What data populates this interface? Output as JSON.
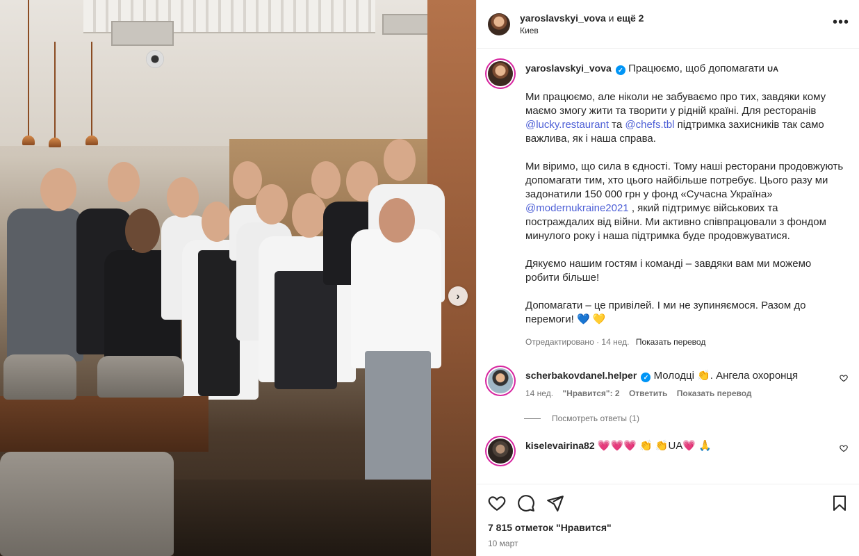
{
  "header": {
    "username": "yaroslavskyi_vova",
    "and_text": "и",
    "more_text": "ещё 2",
    "location": "Киев",
    "menu_icon": "more-horizontal-icon"
  },
  "post": {
    "author": "yaroslavskyi_vova",
    "verified_mark": "✓",
    "caption_title": "Працюємо, щоб допомагати",
    "caption_title_flag": "UA",
    "p1_text1": "Ми працюємо, але ніколи не забуваємо про тих, завдяки кому маємо змогу жити та творити у рідній країні. Для ресторанів ",
    "p1_mention1": "@lucky.restaurant",
    "p1_text2": " та ",
    "p1_mention2": "@chefs.tbl",
    "p1_text3": " підтримка захисників так само важлива, як і наша справа.",
    "p2_text1": "Ми віримо, що сила в єдності. Тому наші ресторани продовжують допомагати тим, хто цього найбільше потребує. Цього разу ми задонатили 150 000 грн у фонд «Сучасна Україна» ",
    "p2_mention": "@modernukraine2021",
    "p2_text2": " , який підтримує військових та постраждалих від війни. Ми активно співпрацювали з фондом минулого року і наша підтримка буде продовжуватися.",
    "p3_text": "Дякуємо нашим гостям і команді – завдяки вам ми можемо робити більше!",
    "p4_text": "Допомагати – це привілей. І ми не зупиняємося. Разом до перемоги!",
    "p4_emojis": "💙 💛",
    "edited": "Отредактировано · 14 нед.",
    "show_translation": "Показать перевод"
  },
  "comments": [
    {
      "username": "scherbakovdanel.helper",
      "verified_mark": "✓",
      "text": "Молодці 👏. Ангела охоронця",
      "age": "14 нед.",
      "likes": "\"Нравится\": 2",
      "reply": "Ответить",
      "translate": "Показать перевод",
      "view_replies": "Посмотреть ответы (1)"
    },
    {
      "username": "kiselevairina82",
      "text": "💗💗💗 👏 👏UA💗 🙏"
    }
  ],
  "actions": {
    "like_icon": "heart-icon",
    "comment_icon": "comment-icon",
    "share_icon": "share-icon",
    "save_icon": "bookmark-icon",
    "likes_text": "7 815 отметок \"Нравится\"",
    "date": "10 март"
  },
  "colors": {
    "link": "#4d5fd6",
    "verified": "#0095f6",
    "muted": "#737373"
  }
}
